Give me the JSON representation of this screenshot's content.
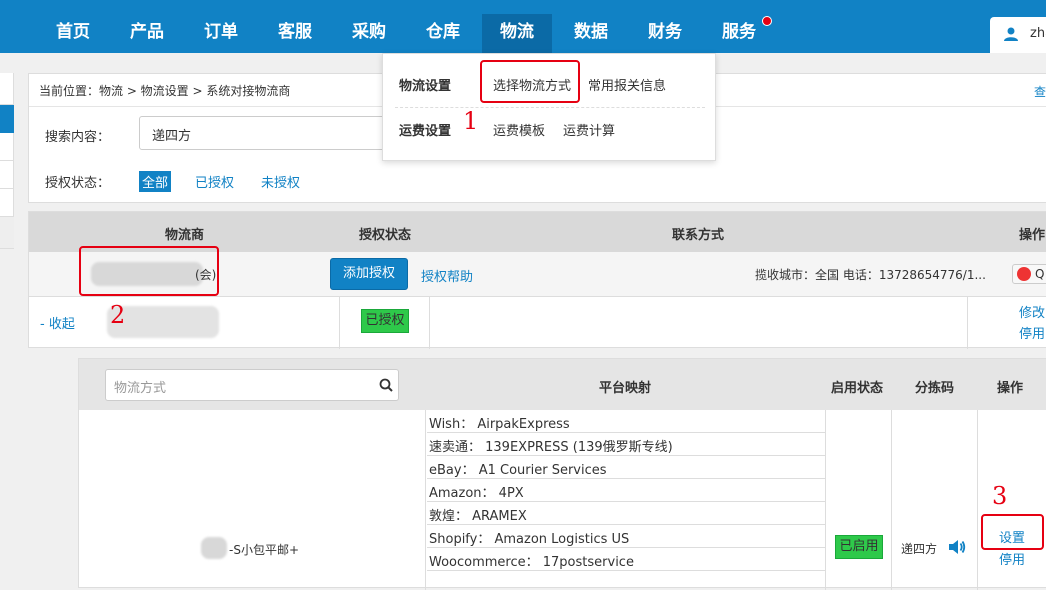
{
  "nav": {
    "items": [
      "首页",
      "产品",
      "订单",
      "客服",
      "采购",
      "仓库",
      "物流",
      "数据",
      "财务",
      "服务"
    ],
    "active": "物流",
    "user": "zha"
  },
  "dropdown": {
    "row1_label": "物流设置",
    "row1_links": [
      "选择物流方式",
      "常用报关信息"
    ],
    "row2_label": "运费设置",
    "row2_links": [
      "运费模板",
      "运费计算"
    ]
  },
  "breadcrumb": "当前位置：物流 > 物流设置 > 系统对接物流商",
  "breadcrumb_right": "查",
  "search": {
    "label": "搜索内容：",
    "value": "递四方"
  },
  "auth_filter": {
    "label": "授权状态：",
    "options": [
      "全部",
      "已授权",
      "未授权"
    ]
  },
  "table1": {
    "headers": [
      "物流商",
      "授权状态",
      "联系方式",
      "操作"
    ],
    "row1": {
      "name_tail": "(会)",
      "add_auth": "添加授权",
      "auth_help": "授权帮助",
      "contact": "揽收城市：全国  电话：13728654776/1...",
      "qq": "Q"
    },
    "row2": {
      "collapse": "- 收起",
      "status": "已授权",
      "actions": [
        "修改",
        "停用"
      ]
    }
  },
  "table2": {
    "search_placeholder": "物流方式",
    "headers": [
      "平台映射",
      "启用状态",
      "分拣码",
      "操作"
    ],
    "method_name": "-S小包平邮+",
    "mappings": [
      "Wish：  AirpakExpress",
      "速卖通：  139EXPRESS (139俄罗斯专线)",
      "eBay：  A1 Courier Services",
      "Amazon：  4PX",
      "敦煌：  ARAMEX",
      "Shopify：  Amazon Logistics US",
      "Woocommerce：  17postservice"
    ],
    "status": "已启用",
    "sort_code": "递四方",
    "actions": [
      "设置",
      "停用"
    ]
  },
  "annotations": [
    "1",
    "2",
    "3"
  ],
  "colors": {
    "primary": "#1182c5",
    "annotation": "#e60012",
    "enabled": "#2ec94a"
  }
}
